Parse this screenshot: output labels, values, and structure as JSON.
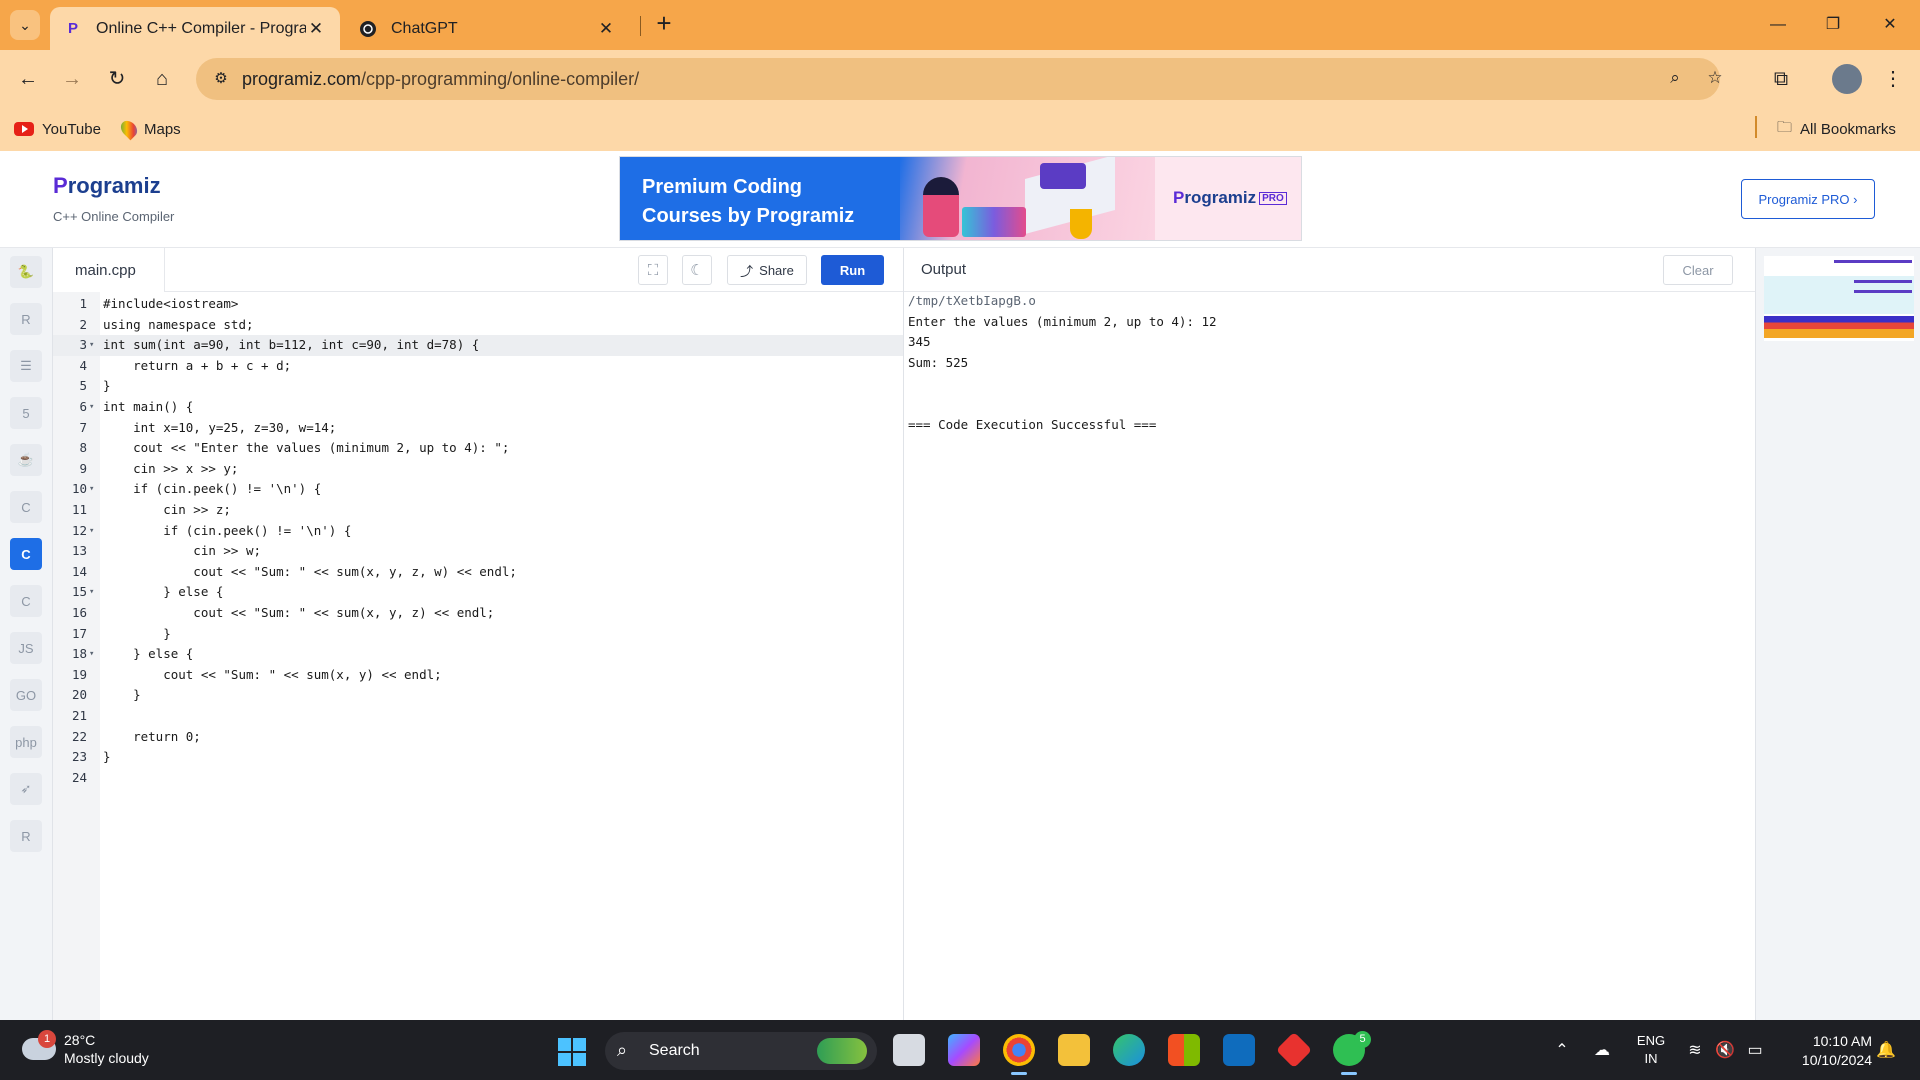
{
  "browser": {
    "tabs": [
      {
        "title": "Online C++ Compiler - Program",
        "favicon": "P",
        "active": true
      },
      {
        "title": "ChatGPT",
        "favicon": "chatgpt-icon",
        "active": false
      }
    ],
    "new_tab_glyph": "+",
    "address_host": "programiz.com",
    "address_path": "/cpp-programming/online-compiler/",
    "bookmarks": [
      {
        "label": "YouTube",
        "icon": "youtube-icon"
      },
      {
        "label": "Maps",
        "icon": "maps-icon"
      }
    ],
    "all_bookmarks": "All Bookmarks",
    "window_controls": {
      "minimize": "—",
      "restore": "❐",
      "close": "✕"
    }
  },
  "site": {
    "logo_initial": "P",
    "logo_rest": "rogramiz",
    "subtitle": "C++ Online Compiler",
    "banner": {
      "line1": "Premium Coding",
      "line2": "Courses by Programiz",
      "pro_initial": "P",
      "pro_rest": "rogramiz",
      "pro_badge": "PRO"
    },
    "pro_button": "Programiz PRO ›"
  },
  "languages": [
    {
      "name": "python-icon",
      "glyph": "🐍",
      "active": false
    },
    {
      "name": "r-icon",
      "glyph": "R",
      "active": false
    },
    {
      "name": "sql-icon",
      "glyph": "☰",
      "active": false
    },
    {
      "name": "html-icon",
      "glyph": "5",
      "active": false
    },
    {
      "name": "java-icon",
      "glyph": "☕",
      "active": false
    },
    {
      "name": "c-icon",
      "glyph": "C",
      "active": false
    },
    {
      "name": "cpp-icon",
      "glyph": "C",
      "active": true
    },
    {
      "name": "csharp-icon",
      "glyph": "C",
      "active": false
    },
    {
      "name": "js-icon",
      "glyph": "JS",
      "active": false
    },
    {
      "name": "go-icon",
      "glyph": "GO",
      "active": false
    },
    {
      "name": "php-icon",
      "glyph": "php",
      "active": false
    },
    {
      "name": "swift-icon",
      "glyph": "➶",
      "active": false
    },
    {
      "name": "rust-icon",
      "glyph": "R",
      "active": false
    }
  ],
  "editor": {
    "filename": "main.cpp",
    "share_label": "Share",
    "run_label": "Run",
    "lines": [
      "#include<iostream>",
      "using namespace std;",
      "int sum(int a=90, int b=112, int c=90, int d=78) {",
      "    return a + b + c + d;",
      "}",
      "int main() {",
      "    int x=10, y=25, z=30, w=14;",
      "    cout << \"Enter the values (minimum 2, up to 4): \";",
      "    cin >> x >> y;",
      "    if (cin.peek() != '\\n') {",
      "        cin >> z;",
      "        if (cin.peek() != '\\n') {",
      "            cin >> w;",
      "            cout << \"Sum: \" << sum(x, y, z, w) << endl;",
      "        } else {",
      "            cout << \"Sum: \" << sum(x, y, z) << endl;",
      "        }",
      "    } else {",
      "        cout << \"Sum: \" << sum(x, y) << endl;",
      "    }",
      "",
      "    return 0;",
      "}",
      ""
    ],
    "fold_lines": [
      3,
      6,
      10,
      12,
      15,
      18
    ],
    "highlighted_line": 3
  },
  "output": {
    "title": "Output",
    "clear_label": "Clear",
    "lines": [
      "/tmp/tXetbIapgB.o",
      "Enter the values (minimum 2, up to 4): 12",
      "345",
      "Sum: 525",
      "",
      "",
      "=== Code Execution Successful ==="
    ]
  },
  "taskbar": {
    "weather_badge": "1",
    "temperature": "28°C",
    "condition": "Mostly cloudy",
    "search_label": "Search",
    "whatsapp_badge": "5",
    "language_line1": "ENG",
    "language_line2": "IN",
    "time": "10:10 AM",
    "date": "10/10/2024"
  }
}
